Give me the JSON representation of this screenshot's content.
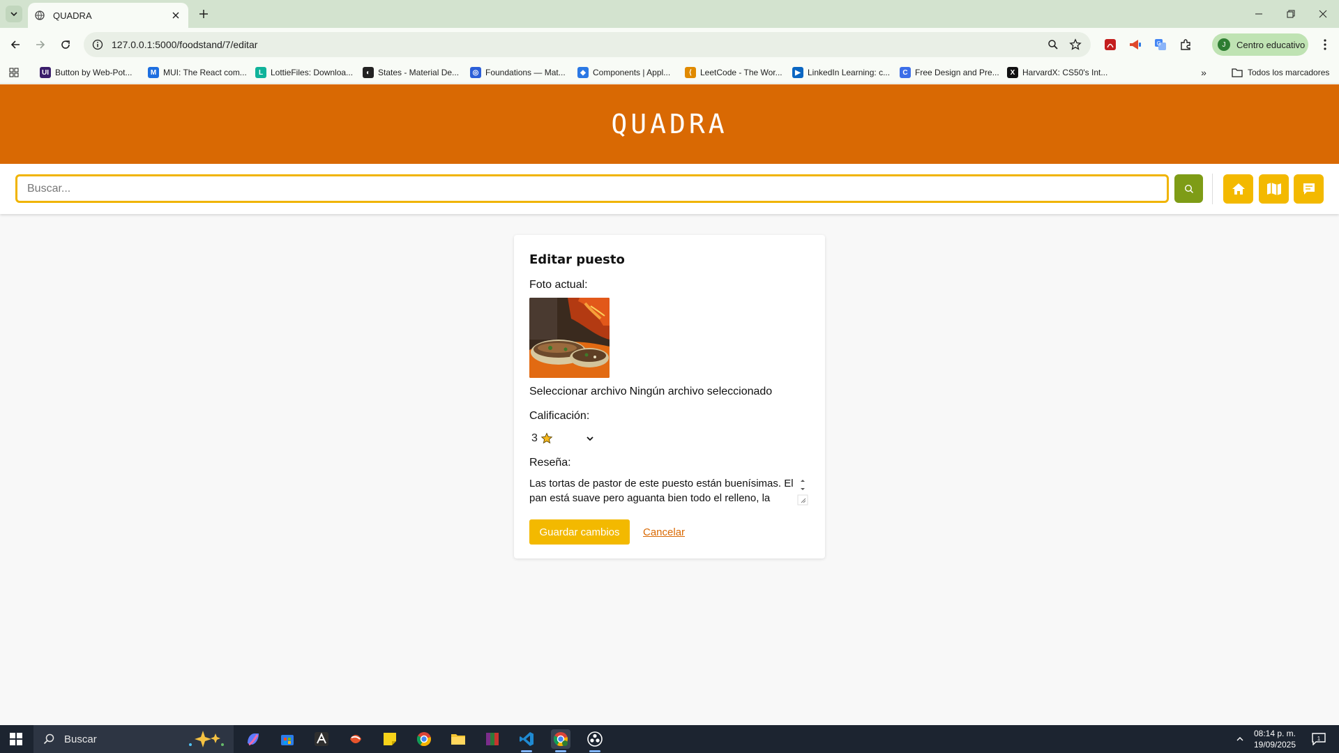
{
  "browser": {
    "tab_title": "QUADRA",
    "url": "127.0.0.1:5000/foodstand/7/editar",
    "profile_initial": "J",
    "profile_label": "Centro educativo",
    "bookmarks": [
      {
        "label": "Button by Web-Pot...",
        "icon_color": "#3a1e6b",
        "icon_text": "UI"
      },
      {
        "label": "MUI: The React com...",
        "icon_color": "#1e6fe0",
        "icon_text": "M"
      },
      {
        "label": "LottieFiles: Downloa...",
        "icon_color": "#10b39a",
        "icon_text": "L"
      },
      {
        "label": "States - Material De...",
        "icon_color": "#222222",
        "icon_text": "◐"
      },
      {
        "label": "Foundations — Mat...",
        "icon_color": "#2b5fd8",
        "icon_text": "◎"
      },
      {
        "label": "Components | Appl...",
        "icon_color": "#2b78e4",
        "icon_text": "◆"
      },
      {
        "label": "LeetCode - The Wor...",
        "icon_color": "#e08a00",
        "icon_text": "⟨"
      },
      {
        "label": "LinkedIn Learning: c...",
        "icon_color": "#0a66c2",
        "icon_text": "▶"
      },
      {
        "label": "Free Design and Pre...",
        "icon_color": "#3b6ee8",
        "icon_text": "C"
      },
      {
        "label": "HarvardX: CS50's Int...",
        "icon_color": "#111111",
        "icon_text": "X"
      }
    ],
    "all_bookmarks": "Todos los marcadores"
  },
  "site": {
    "brand": "QUADRA",
    "search_placeholder": "Buscar..."
  },
  "form": {
    "title": "Editar puesto",
    "photo_label": "Foto actual:",
    "file_button": "Seleccionar archivo",
    "file_status": "Ningún archivo seleccionado",
    "rating_label": "Calificación:",
    "rating_value": "3",
    "rating_icon": "star-icon",
    "review_label": "Reseña:",
    "review_text": "Las tortas de pastor de este puesto están buenísimas. El pan está suave pero aguanta bien todo el relleno, la",
    "save_button": "Guardar cambios",
    "cancel_link": "Cancelar"
  },
  "taskbar": {
    "search_text": "Buscar",
    "time": "08:14 p. m.",
    "date": "19/09/2025",
    "notif_count": "1"
  },
  "colors": {
    "header_orange": "#d96903",
    "accent_yellow": "#f3b900",
    "search_green": "#7e9c16"
  }
}
